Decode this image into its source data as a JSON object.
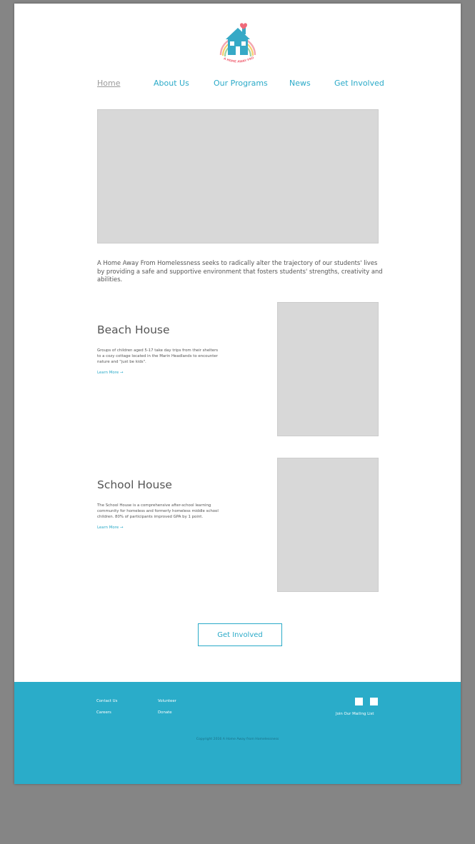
{
  "brand": {
    "logo_text": "A HOME AWAY FROM HOMELESSNESS",
    "colors": {
      "accent": "#2aaac8",
      "heart": "#f06a7a",
      "house": "#36a9c6"
    }
  },
  "nav": {
    "items": [
      {
        "label": "Home",
        "active": true
      },
      {
        "label": "About Us"
      },
      {
        "label": "Our Programs"
      },
      {
        "label": "News"
      },
      {
        "label": "Get Involved"
      }
    ]
  },
  "intro": {
    "text": "A Home Away From Homelessness seeks to radically alter the trajectory of our students' lives by providing a safe and supportive environment that fosters students' strengths, creativity and abilities."
  },
  "programs": [
    {
      "title": "Beach House",
      "description": "Groups of children aged 5-17 take day trips from their shelters to a cozy cottage located in the Marin Headlands to encounter nature and \"just be kids\".",
      "link": "Learn More →"
    },
    {
      "title": "School House",
      "description": "The School House is a comprehensive after-school learning community for homeless and formerly homeless middle school children. 80% of participants improved GPA by 1 point.",
      "link": "Learn More →"
    }
  ],
  "cta": {
    "label": "Get Involved"
  },
  "footer": {
    "links": [
      "Contact Us",
      "Volunteer",
      "Careers",
      "Donate"
    ],
    "mailing_list": "Join Our Mailing List",
    "copyright": "Copyright 2016 A Home Away from Homelessness"
  }
}
